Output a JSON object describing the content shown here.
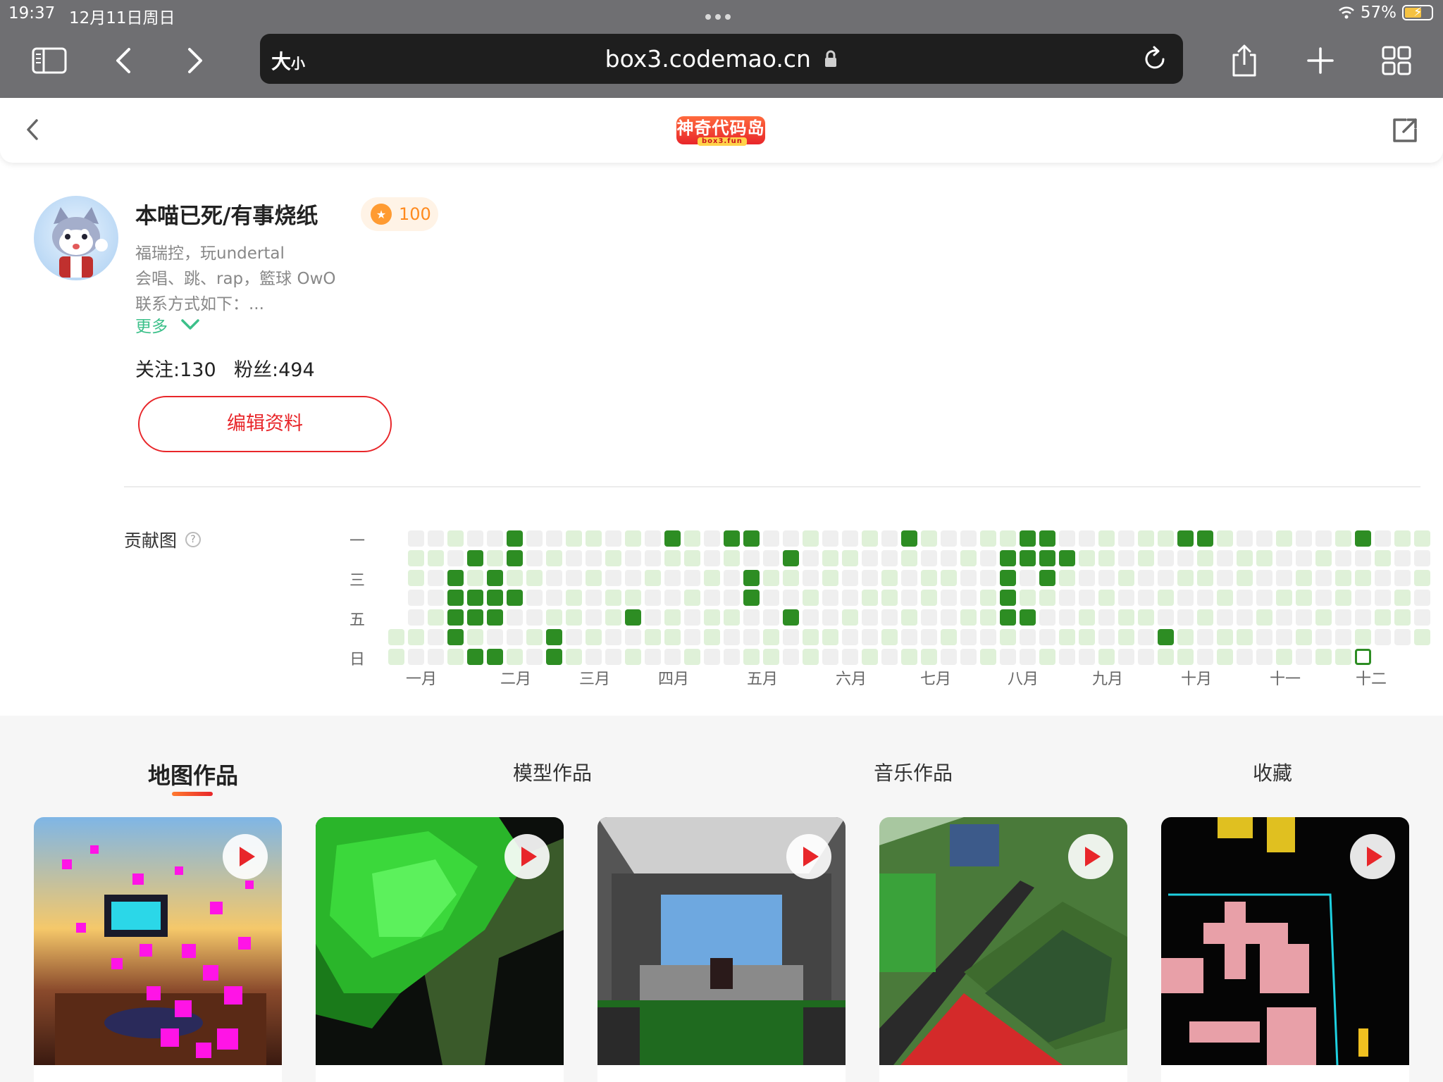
{
  "status": {
    "time": "19:37",
    "date": "12月11日周日",
    "battery": "57%"
  },
  "browser": {
    "size_label": "大",
    "size_small": "小",
    "url": "box3.codemao.cn"
  },
  "site": {
    "logo_text": "神奇代码岛",
    "logo_sub": "box3.fun"
  },
  "profile": {
    "name": "本喵已死/有事烧纸",
    "coins": "100",
    "bio": [
      "福瑞控，玩undertal",
      "会唱、跳、rap，籃球 OwO",
      "联系方式如下：..."
    ],
    "more": "更多",
    "following": "关注:130",
    "followers": "粉丝:494",
    "edit_button": "编辑资料"
  },
  "contrib": {
    "title": "贡献图",
    "day_labels": [
      "一",
      "三",
      "五",
      "日"
    ],
    "months": [
      "一月",
      "二月",
      "三月",
      "四月",
      "五月",
      "六月",
      "七月",
      "八月",
      "九月",
      "十月",
      "十一",
      "十二"
    ],
    "dark_cells": [
      [
        6,
        0
      ],
      [
        4,
        1
      ],
      [
        6,
        1
      ],
      [
        3,
        2
      ],
      [
        5,
        2
      ],
      [
        3,
        3
      ],
      [
        4,
        3
      ],
      [
        5,
        3
      ],
      [
        6,
        3
      ],
      [
        4,
        4
      ],
      [
        5,
        4
      ],
      [
        3,
        4
      ],
      [
        3,
        5
      ],
      [
        4,
        6
      ],
      [
        5,
        6
      ],
      [
        8,
        6
      ],
      [
        8,
        5
      ],
      [
        12,
        4
      ],
      [
        14,
        0
      ],
      [
        17,
        0
      ],
      [
        18,
        0
      ],
      [
        18,
        2
      ],
      [
        18,
        3
      ],
      [
        20,
        1
      ],
      [
        20,
        4
      ],
      [
        26,
        0
      ],
      [
        32,
        0
      ],
      [
        33,
        0
      ],
      [
        31,
        1
      ],
      [
        32,
        1
      ],
      [
        33,
        1
      ],
      [
        34,
        1
      ],
      [
        31,
        2
      ],
      [
        33,
        2
      ],
      [
        31,
        3
      ],
      [
        31,
        4
      ],
      [
        32,
        4
      ],
      [
        40,
        0
      ],
      [
        41,
        0
      ],
      [
        39,
        5
      ],
      [
        49,
        0
      ]
    ],
    "today_cell": [
      49,
      6
    ]
  },
  "tabs": [
    "地图作品",
    "模型作品",
    "音乐作品",
    "收藏"
  ],
  "colors": {
    "accent": "#e8262a",
    "green_dark": "#2d8d23",
    "green_light": "#dff1d8",
    "empty": "#efefef"
  }
}
